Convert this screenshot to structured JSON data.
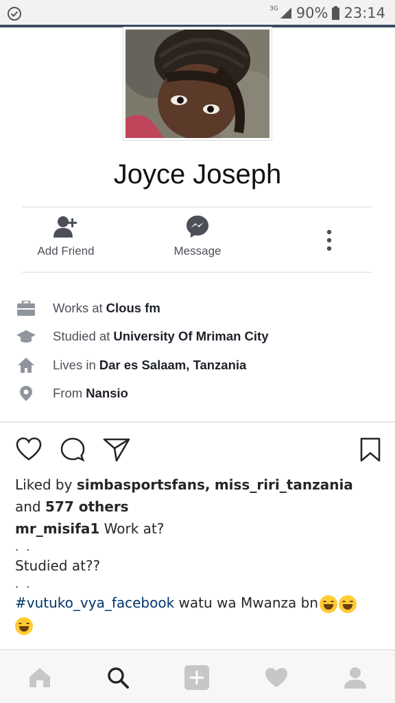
{
  "status_bar": {
    "network": "3G",
    "battery": "90%",
    "time": "23:14"
  },
  "profile": {
    "name": "Joyce Joseph",
    "photo_alt": "profile-photo"
  },
  "actions": {
    "add_friend": "Add Friend",
    "message": "Message"
  },
  "info": [
    {
      "icon": "briefcase-icon",
      "prefix": "Works at",
      "value": "Clous fm"
    },
    {
      "icon": "graduation-cap-icon",
      "prefix": "Studied at",
      "value": "University Of Mriman City"
    },
    {
      "icon": "home-icon",
      "prefix": "Lives in",
      "value": "Dar es Salaam, Tanzania"
    },
    {
      "icon": "location-pin-icon",
      "prefix": "From",
      "value": "Nansio"
    }
  ],
  "post": {
    "liked_by_prefix": "Liked by",
    "liker1": "simbasportsfans,",
    "liker2": "miss_riri_tanzania",
    "and": "and",
    "others": "577 others",
    "author": "mr_misifa1",
    "line1": "Work at?",
    "dots": ". .",
    "line2": "Studied at??",
    "hashtag": "#vutuko_vya_facebook",
    "line3": "watu wa Mwanza bn"
  },
  "colors": {
    "status_accent": "#3b4a62",
    "hashtag": "#003569",
    "icon_gray": "#4b4f56"
  }
}
